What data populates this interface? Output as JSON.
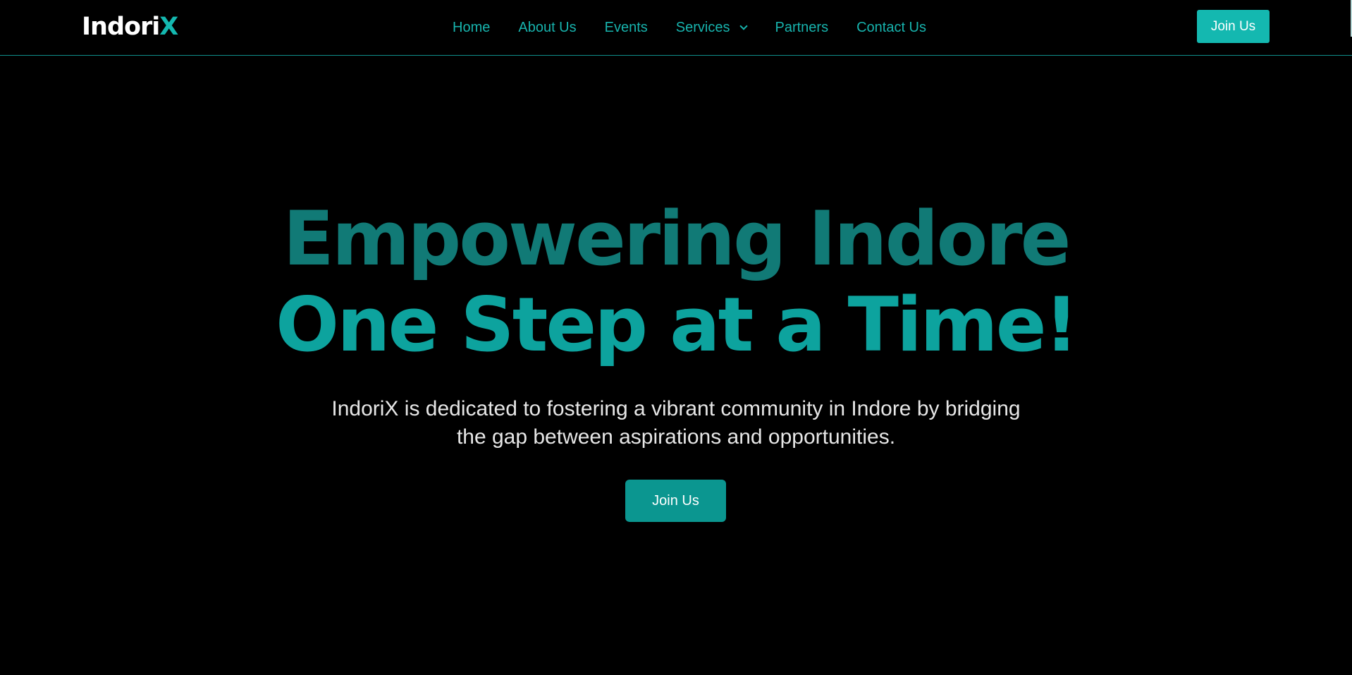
{
  "brand": {
    "name_main": "Indori",
    "name_accent": "X"
  },
  "nav": {
    "items": [
      {
        "label": "Home"
      },
      {
        "label": "About Us"
      },
      {
        "label": "Events"
      },
      {
        "label": "Services",
        "icon": "chevron-down-icon"
      },
      {
        "label": "Partners"
      },
      {
        "label": "Contact Us"
      }
    ]
  },
  "header": {
    "join_label": "Join Us"
  },
  "hero": {
    "title_line1": "Empowering Indore",
    "title_line2": "One Step at a Time!",
    "subtitle": "IndoriX is dedicated to fostering a vibrant community in Indore by bridging the gap between aspirations and opportunities.",
    "cta_label": "Join Us"
  },
  "colors": {
    "background": "#000000",
    "accent": "#14b8b0",
    "title_line1": "#117a76",
    "title_line2": "#0da39e",
    "cta": "#0b9690"
  }
}
